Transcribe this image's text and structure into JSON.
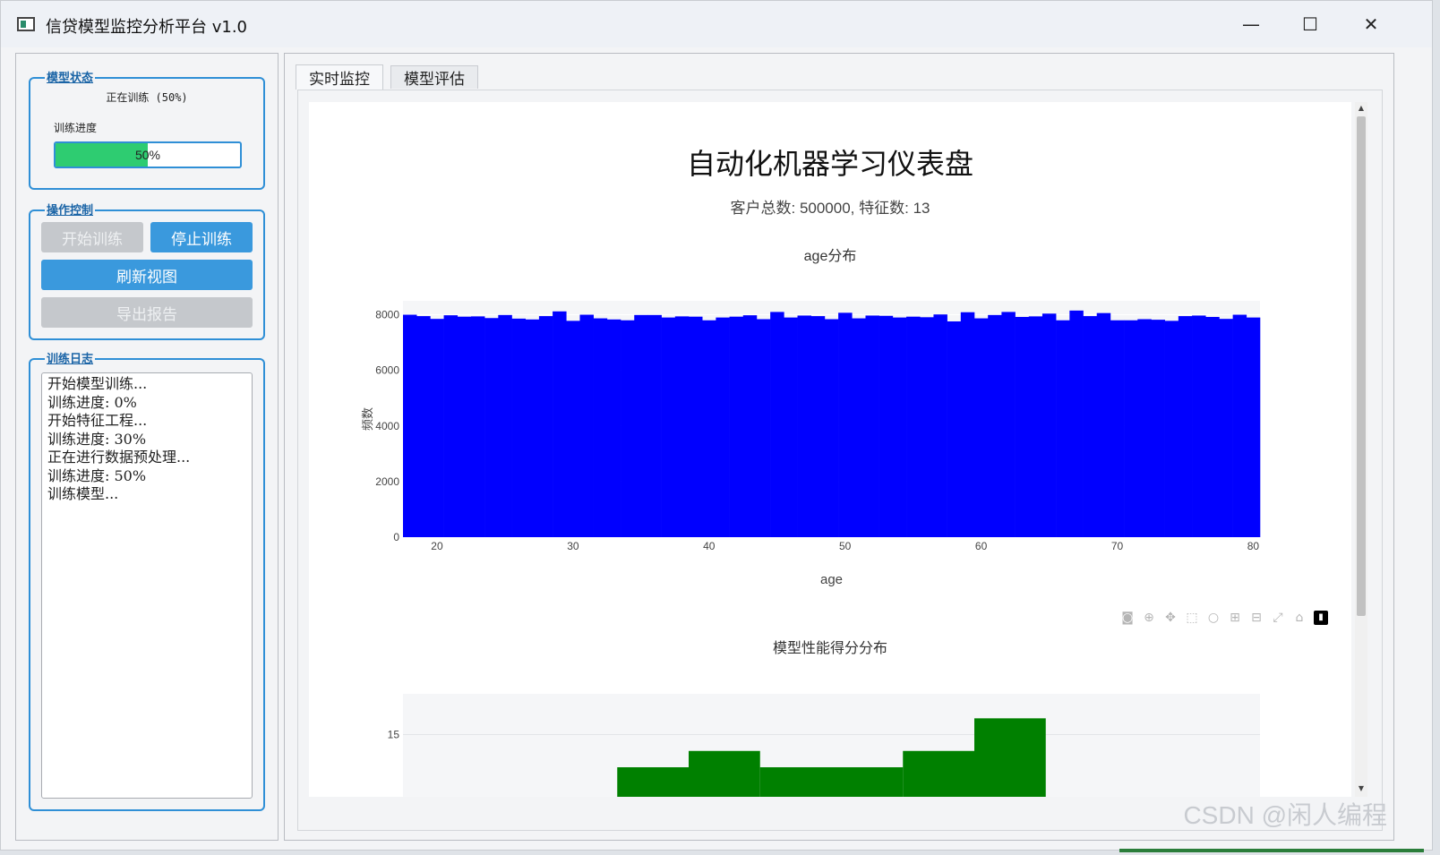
{
  "window": {
    "title": "信贷模型监控分析平台 v1.0",
    "minimize": "—",
    "maximize": "☐",
    "close": "✕"
  },
  "status_group": {
    "title": "模型状态",
    "status_text": "正在训练 (50%)",
    "progress_label": "训练进度",
    "progress_value": 50,
    "progress_text": "50%"
  },
  "control_group": {
    "title": "操作控制",
    "start": "开始训练",
    "stop": "停止训练",
    "refresh": "刷新视图",
    "export": "导出报告"
  },
  "log_group": {
    "title": "训练日志",
    "lines": [
      "开始模型训练...",
      "训练进度: 0%",
      "开始特征工程...",
      "训练进度: 30%",
      "正在进行数据预处理...",
      "训练进度: 50%",
      "训练模型..."
    ]
  },
  "tabs": [
    "实时监控",
    "模型评估"
  ],
  "dashboard": {
    "title": "自动化机器学习仪表盘",
    "subtitle": "客户总数: 500000, 特征数: 13"
  },
  "chart_data": [
    {
      "type": "bar",
      "title": "age分布",
      "xlabel": "age",
      "ylabel": "频数",
      "color": "#0000ff",
      "xlim": [
        17.5,
        80.5
      ],
      "ylim": [
        0,
        8500
      ],
      "xticks": [
        20,
        30,
        40,
        50,
        60,
        70,
        80
      ],
      "yticks": [
        0,
        2000,
        4000,
        6000,
        8000
      ],
      "bin_start": 18,
      "bin_width": 1,
      "values": [
        8000,
        7950,
        7850,
        7980,
        7930,
        7940,
        7880,
        7990,
        7860,
        7830,
        7950,
        8120,
        7780,
        8000,
        7870,
        7830,
        7800,
        7990,
        7990,
        7900,
        7940,
        7930,
        7800,
        7900,
        7930,
        7980,
        7840,
        8100,
        7900,
        7970,
        7950,
        7840,
        8070,
        7870,
        7970,
        7960,
        7900,
        7930,
        7910,
        8010,
        7760,
        8090,
        7870,
        7990,
        8100,
        7920,
        7940,
        8040,
        7800,
        8150,
        7950,
        8060,
        7800,
        7800,
        7840,
        7820,
        7780,
        7950,
        7970,
        7920,
        7850,
        8000,
        7900
      ]
    },
    {
      "type": "bar",
      "title": "模型性能得分分布",
      "color": "#008000",
      "ylim": [
        8.5,
        17.5
      ],
      "yticks": [
        10,
        15
      ],
      "bins": [
        {
          "x0": 0.44,
          "x1": 0.525,
          "value": 13
        },
        {
          "x0": 0.525,
          "x1": 0.61,
          "value": 14
        },
        {
          "x0": 0.61,
          "x1": 0.695,
          "value": 13
        },
        {
          "x0": 0.695,
          "x1": 0.78,
          "value": 13
        },
        {
          "x0": 0.78,
          "x1": 0.865,
          "value": 14
        },
        {
          "x0": 0.865,
          "x1": 0.95,
          "value": 16
        }
      ],
      "xlim": [
        0.185,
        1.205
      ]
    }
  ],
  "modebar": [
    "camera-icon",
    "zoom-icon",
    "pan-icon",
    "box-select-icon",
    "lasso-icon",
    "zoom-in-icon",
    "zoom-out-icon",
    "autoscale-icon",
    "reset-axes-icon",
    "plotly-logo-icon"
  ],
  "watermark": "CSDN @闲人编程"
}
